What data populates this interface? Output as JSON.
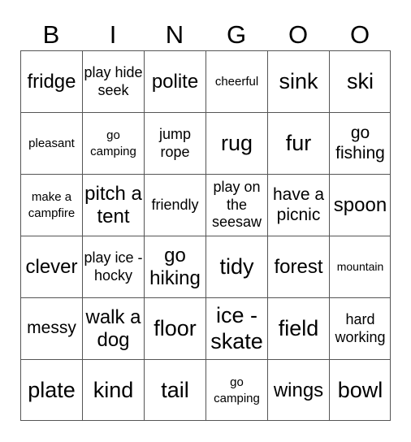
{
  "header": [
    "B",
    "I",
    "N",
    "G",
    "O",
    "O"
  ],
  "grid": [
    [
      {
        "text": "fridge",
        "size": "l"
      },
      {
        "text": "play hide seek",
        "size": "s"
      },
      {
        "text": "polite",
        "size": "l"
      },
      {
        "text": "cheerful",
        "size": "xs"
      },
      {
        "text": "sink",
        "size": "xl"
      },
      {
        "text": "ski",
        "size": "xl"
      }
    ],
    [
      {
        "text": "pleasant",
        "size": "xs"
      },
      {
        "text": "go camping",
        "size": "xs"
      },
      {
        "text": "jump rope",
        "size": "s"
      },
      {
        "text": "rug",
        "size": "xl"
      },
      {
        "text": "fur",
        "size": "xl"
      },
      {
        "text": "go fishing",
        "size": "m"
      }
    ],
    [
      {
        "text": "make a campfire",
        "size": "xs"
      },
      {
        "text": "pitch a tent",
        "size": "l"
      },
      {
        "text": "friendly",
        "size": "s"
      },
      {
        "text": "play on the seesaw",
        "size": "s"
      },
      {
        "text": "have a picnic",
        "size": "m"
      },
      {
        "text": "spoon",
        "size": "l"
      }
    ],
    [
      {
        "text": "clever",
        "size": "l"
      },
      {
        "text": "play ice - hocky",
        "size": "s"
      },
      {
        "text": "go hiking",
        "size": "l"
      },
      {
        "text": "tidy",
        "size": "xl"
      },
      {
        "text": "forest",
        "size": "l"
      },
      {
        "text": "mountain",
        "size": "xxs"
      }
    ],
    [
      {
        "text": "messy",
        "size": "m"
      },
      {
        "text": "walk a dog",
        "size": "l"
      },
      {
        "text": "floor",
        "size": "xl"
      },
      {
        "text": "ice - skate",
        "size": "xl"
      },
      {
        "text": "field",
        "size": "xl"
      },
      {
        "text": "hard working",
        "size": "s"
      }
    ],
    [
      {
        "text": "plate",
        "size": "xl"
      },
      {
        "text": "kind",
        "size": "xl"
      },
      {
        "text": "tail",
        "size": "xl"
      },
      {
        "text": "go camping",
        "size": "xs"
      },
      {
        "text": "wings",
        "size": "l"
      },
      {
        "text": "bowl",
        "size": "xl"
      }
    ]
  ]
}
